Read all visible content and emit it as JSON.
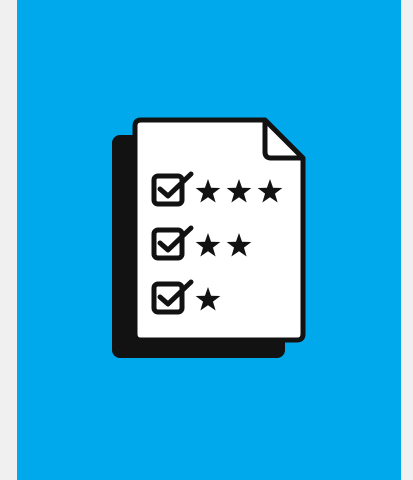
{
  "colors": {
    "page_background": "#f0f0f0",
    "panel_background": "#00a8ec",
    "ink": "#121212",
    "paper": "#ffffff"
  },
  "icon": {
    "name": "rating-checklist-document-icon",
    "rows": [
      {
        "checked": true,
        "stars": 3
      },
      {
        "checked": true,
        "stars": 2
      },
      {
        "checked": true,
        "stars": 1
      }
    ]
  }
}
